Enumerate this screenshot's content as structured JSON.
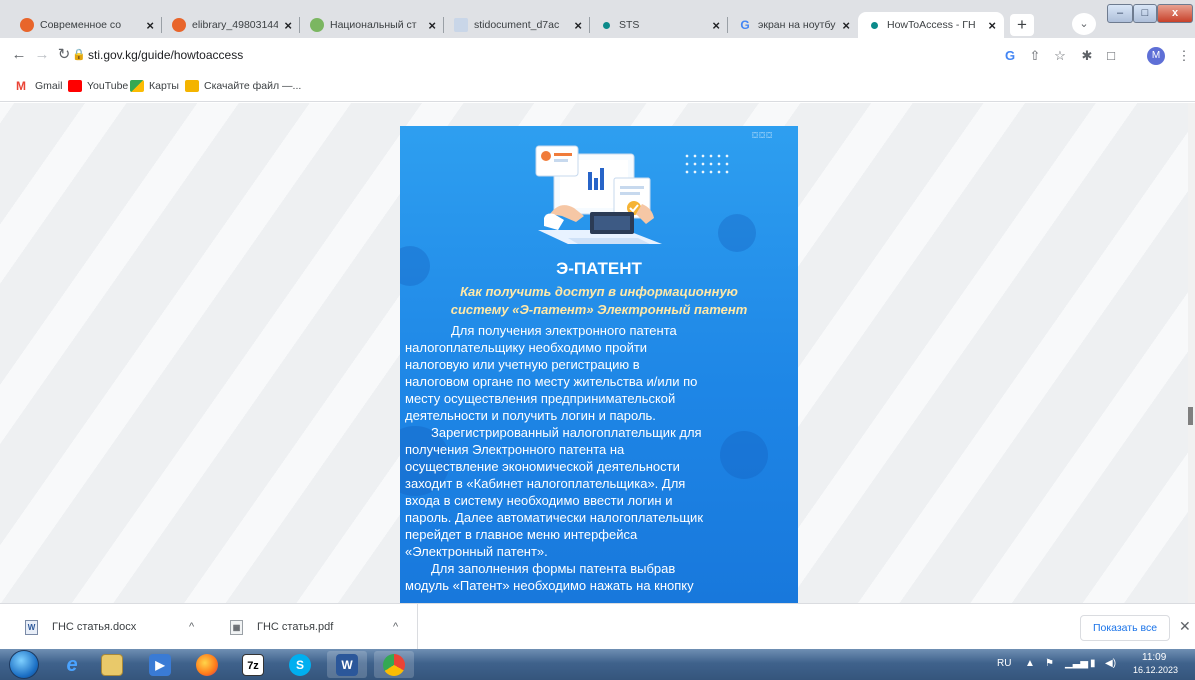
{
  "tabs": [
    {
      "title": "Современное со",
      "favicon_color": "#e8652b",
      "active": false
    },
    {
      "title": "elibrary_49803144",
      "favicon_color": "#e8652b",
      "active": false
    },
    {
      "title": "Национальный ст",
      "favicon_color": "#7bb661",
      "active": false
    },
    {
      "title": "stidocument_d7ac",
      "favicon_color": "#c9d6e8",
      "active": false
    },
    {
      "title": "STS",
      "favicon_color": "#0b8a8a",
      "active": false
    },
    {
      "title": "экран на ноутбук",
      "favicon_color": "#4285f4",
      "active": false
    },
    {
      "title": "HowToAccess - ГН",
      "favicon_color": "#0b8a8a",
      "active": true
    }
  ],
  "window": {
    "minimize": "–",
    "maximize": "□",
    "close": "x"
  },
  "toolbar": {
    "url": "sti.gov.kg/guide/howtoaccess",
    "profile_initial": "M"
  },
  "bookmarks": [
    {
      "label": "Gmail",
      "icon": "gmail-icon",
      "color": "#ea4335"
    },
    {
      "label": "YouTube",
      "icon": "youtube-icon",
      "color": "#ff0000"
    },
    {
      "label": "Карты",
      "icon": "maps-icon",
      "color": "#34a853"
    },
    {
      "label": "Скачайте файл —...",
      "icon": "download-file-icon",
      "color": "#f4b400"
    }
  ],
  "poster": {
    "title": "Э-ПАТЕНТ",
    "subtitle_lines": [
      "Как получить доступ в информационную",
      "систему «Э-патент» Электронный патент"
    ],
    "body_lines": [
      "Для получения электронного патента",
      "налогоплательщику необходимо пройти",
      "налоговую или учетную регистрацию в",
      "налоговом органе по месту жительства и/или по",
      "месту осуществления предпринимательской",
      "деятельности и получить логин и пароль.",
      "Зарегистрированный налогоплательщик для",
      "получения Электронного патента на",
      "осуществление экономической деятельности",
      "заходит в «Кабинет налогоплательщика». Для",
      "входа в систему необходимо ввести логин и",
      "пароль. Далее автоматически налогоплательщик",
      "перейдет в главное меню интерфейса",
      "«Электронный патент».",
      "Для заполнения формы патента выбрав",
      "модуль «Патент» необходимо нажать на кнопку"
    ],
    "colors": {
      "background": "#1e86e6",
      "subtitle": "#ffe9a8"
    }
  },
  "downloads": {
    "items": [
      {
        "name": "ГНС статья.docx",
        "icon": "word-file-icon"
      },
      {
        "name": "ГНС статья.pdf",
        "icon": "pdf-file-icon"
      }
    ],
    "show_all": "Показать все"
  },
  "taskbar": {
    "lang": "RU",
    "time": "11:09",
    "date": "16.12.2023"
  }
}
